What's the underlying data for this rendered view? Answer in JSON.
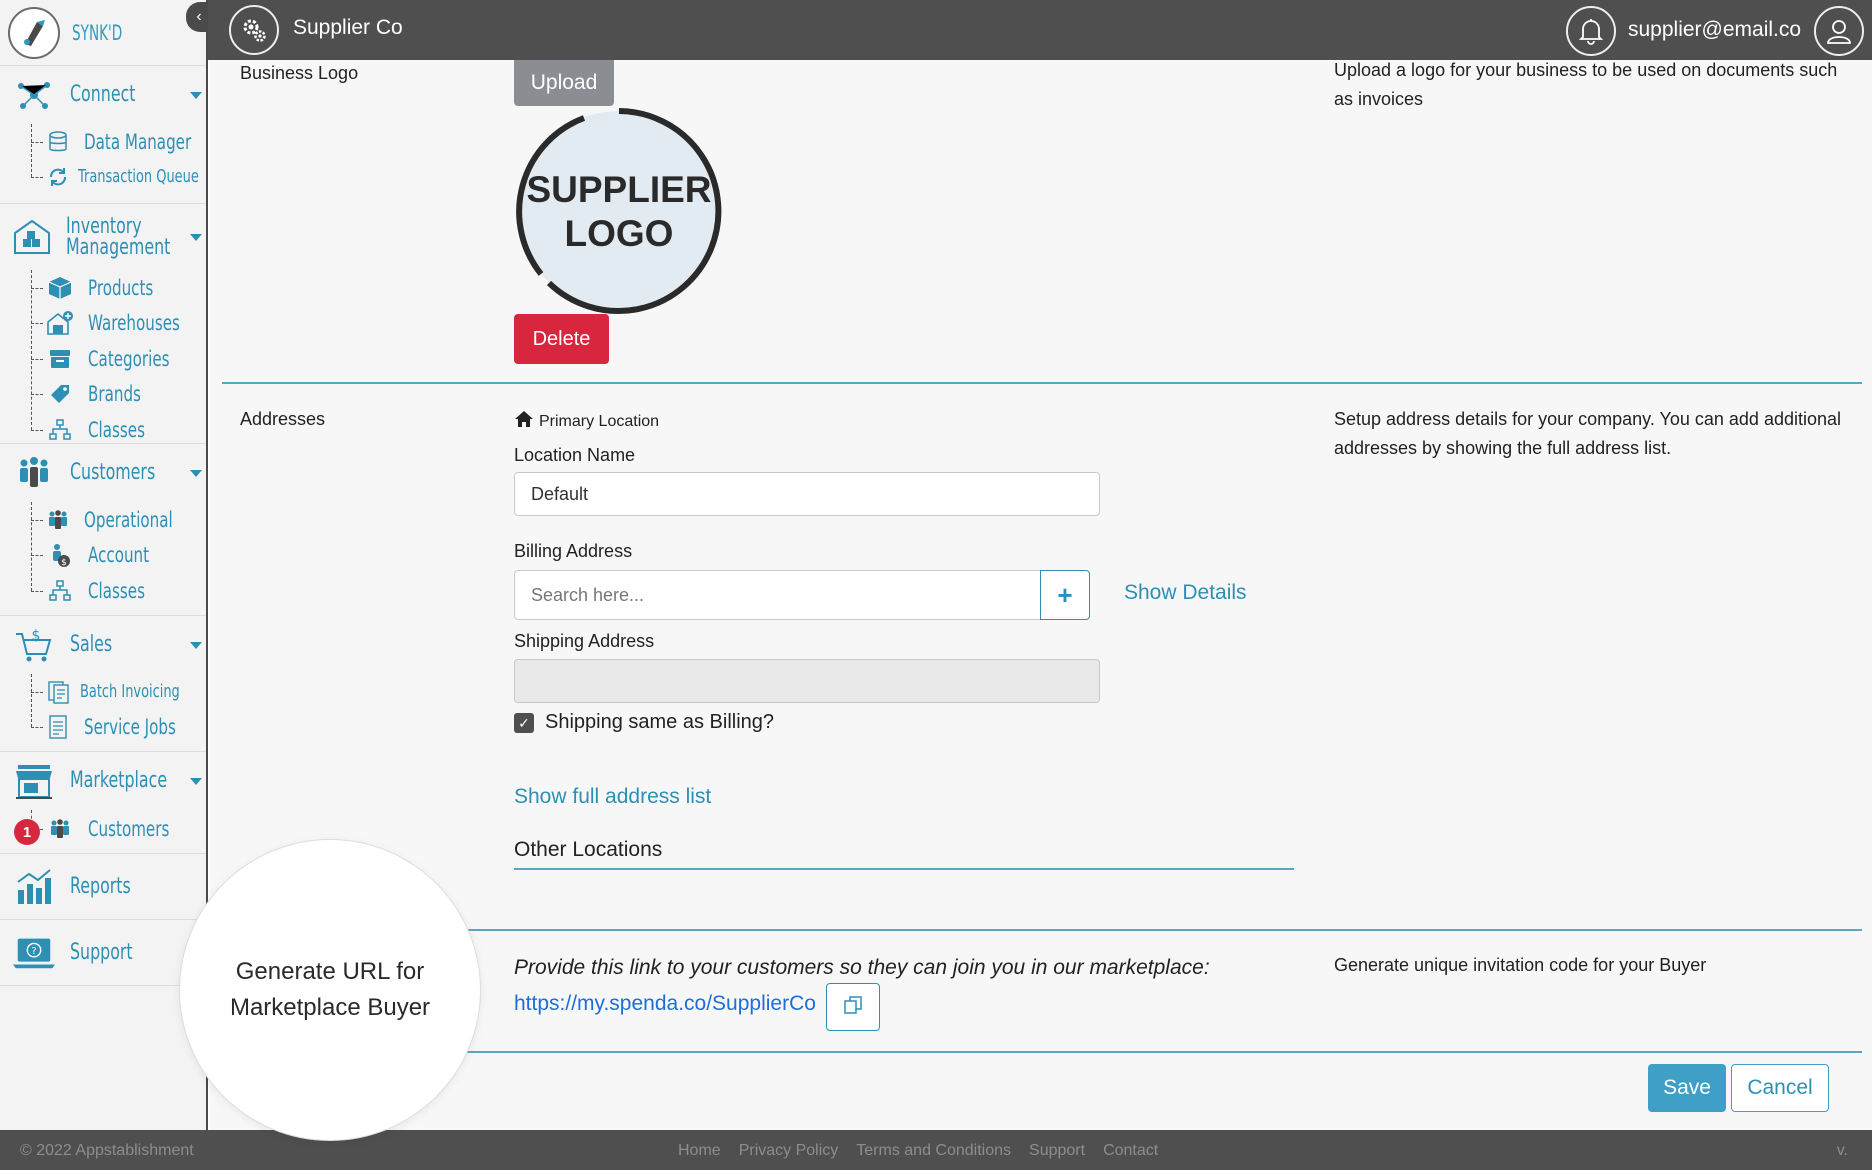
{
  "brand": {
    "name": "SYNK'D"
  },
  "sidebar": {
    "connect": {
      "label": "Connect",
      "items": [
        {
          "label": "Data Manager"
        },
        {
          "label": "Transaction Queue"
        }
      ]
    },
    "inventory": {
      "label_line1": "Inventory",
      "label_line2": "Management",
      "items": [
        {
          "label": "Products"
        },
        {
          "label": "Warehouses"
        },
        {
          "label": "Categories"
        },
        {
          "label": "Brands"
        },
        {
          "label": "Classes"
        }
      ]
    },
    "customers": {
      "label": "Customers",
      "items": [
        {
          "label": "Operational"
        },
        {
          "label": "Account"
        },
        {
          "label": "Classes"
        }
      ]
    },
    "sales": {
      "label": "Sales",
      "items": [
        {
          "label": "Batch Invoicing"
        },
        {
          "label": "Service Jobs"
        }
      ]
    },
    "marketplace": {
      "label": "Marketplace",
      "items": [
        {
          "label": "Customers",
          "badge": "1"
        }
      ]
    },
    "reports": {
      "label": "Reports"
    },
    "support": {
      "label": "Support"
    }
  },
  "header": {
    "title": "Supplier Co",
    "email": "supplier@email.co"
  },
  "business_logo": {
    "label": "Business Logo",
    "upload_label": "Upload",
    "logo_line1": "SUPPLIER",
    "logo_line2": "LOGO",
    "delete_label": "Delete",
    "description": "Upload a logo for your business to be used on documents such as invoices"
  },
  "addresses": {
    "label": "Addresses",
    "primary_location": "Primary Location",
    "location_name_label": "Location Name",
    "location_name_value": "Default",
    "billing_label": "Billing Address",
    "billing_placeholder": "Search here...",
    "show_details": "Show Details",
    "shipping_label": "Shipping Address",
    "shipping_value": "",
    "same_as_billing": "Shipping same as Billing?",
    "same_as_billing_checked": true,
    "show_full_list": "Show full address list",
    "other_locations": "Other Locations",
    "description": "Setup address details for your company. You can add additional addresses by showing the full address list."
  },
  "marketplace_link": {
    "prompt": "Provide this link to your customers so they can join you in our marketplace:",
    "url": "https://my.spenda.co/SupplierCo",
    "description": "Generate unique invitation code for your Buyer"
  },
  "actions": {
    "save": "Save",
    "cancel": "Cancel"
  },
  "callout": {
    "line1": "Generate URL for",
    "line2": "Marketplace Buyer"
  },
  "footer": {
    "copyright": "© 2022 Appstablishment",
    "links": [
      "Home",
      "Privacy Policy",
      "Terms and Conditions",
      "Support",
      "Contact"
    ],
    "version": "v."
  },
  "colors": {
    "accent": "#2e8fb5",
    "danger": "#d9263f",
    "header": "#4f4f4f",
    "link": "#1d6ed8"
  }
}
